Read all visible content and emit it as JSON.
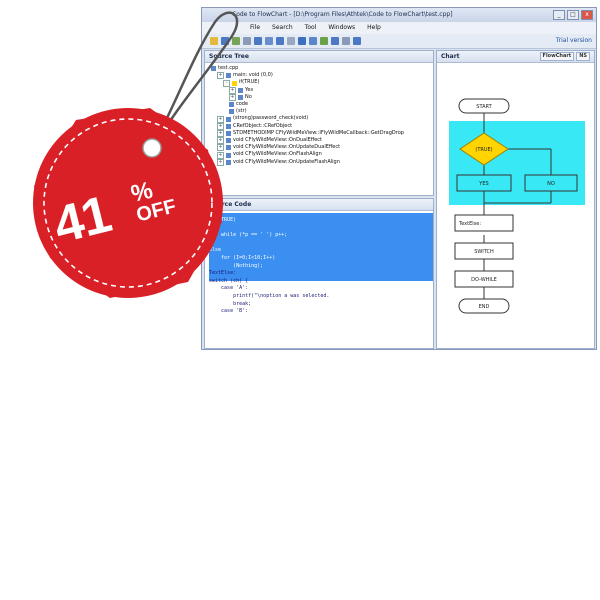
{
  "window": {
    "title": "Code to FlowChart - [D:\\Program Files\\Athtek\\Code to FlowChart\\test.cpp]",
    "minimize": "_",
    "maximize": "□",
    "close": "x"
  },
  "menu": {
    "items": [
      "File",
      "Search",
      "Tool",
      "Windows",
      "Help"
    ]
  },
  "toolbar": {
    "trial": "Trial version"
  },
  "tree_panel": {
    "title": "Source Tree",
    "items": [
      "test.cpp",
      "main: void (0,0)",
      "if(TRUE)",
      "Yes",
      "No",
      "code",
      "(str)",
      "(strong)password_check(void)",
      "CRefObject::CRefObject",
      "STDMETHODIMP CFlyWildMeView::IFlyWildMeCallback::GetDragDrop",
      "void CFlyWildMeView::OnDualEffect",
      "void CFlyWildMeView::OnUpdateDualEffect",
      "void CFlyWildMeView::OnFlashAlign",
      "void CFlyWildMeView::OnUpdateFlashAlign"
    ]
  },
  "code_panel": {
    "title": "Source Code",
    "lines": [
      "if (TRUE)",
      "{",
      "    while (*p == ' ') p++;",
      "}",
      "else",
      "    for (I=0;I<10;I++)",
      "        (Nothing);",
      "TextElse:",
      "switch (ch) {",
      "    case 'A':",
      "        printf(\"\\noption a was selected.",
      "        break;",
      "    case 'B':"
    ]
  },
  "chart_panel": {
    "title": "Chart",
    "tabs": [
      "FlowChart",
      "NS"
    ],
    "nodes": {
      "start": "START",
      "decision": "(TRUE)",
      "yes": "YES",
      "no": "NO",
      "textelse": "TextElse:",
      "switch": "SWITCH",
      "dowhile": "DO-WHILE",
      "end": "END"
    }
  },
  "tag": {
    "number": "41",
    "percent": "%",
    "off": "OFF"
  },
  "colors": {
    "tag_red": "#d92027",
    "highlight": "#3a8ff0",
    "chart_cyan": "#38e8f4",
    "decision": "#ffd400"
  }
}
